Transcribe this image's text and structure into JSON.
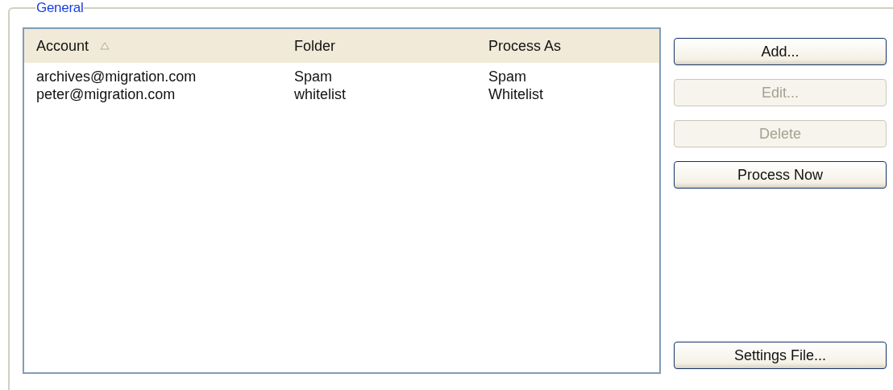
{
  "group": {
    "title": "General"
  },
  "table": {
    "columns": [
      {
        "label": "Account",
        "sorted": true
      },
      {
        "label": "Folder",
        "sorted": false
      },
      {
        "label": "Process As",
        "sorted": false
      }
    ],
    "rows": [
      [
        "archives@migration.com",
        "Spam",
        "Spam"
      ],
      [
        "peter@migration.com",
        "whitelist",
        "Whitelist"
      ]
    ]
  },
  "buttons": [
    {
      "label": "Add...",
      "disabled": false,
      "kind": "top"
    },
    {
      "label": "Edit...",
      "disabled": true,
      "kind": "top"
    },
    {
      "label": "Delete",
      "disabled": true,
      "kind": "top"
    },
    {
      "label": "Process Now",
      "disabled": false,
      "kind": "top"
    },
    {
      "label": "Settings File...",
      "disabled": false,
      "kind": "bottom"
    }
  ]
}
